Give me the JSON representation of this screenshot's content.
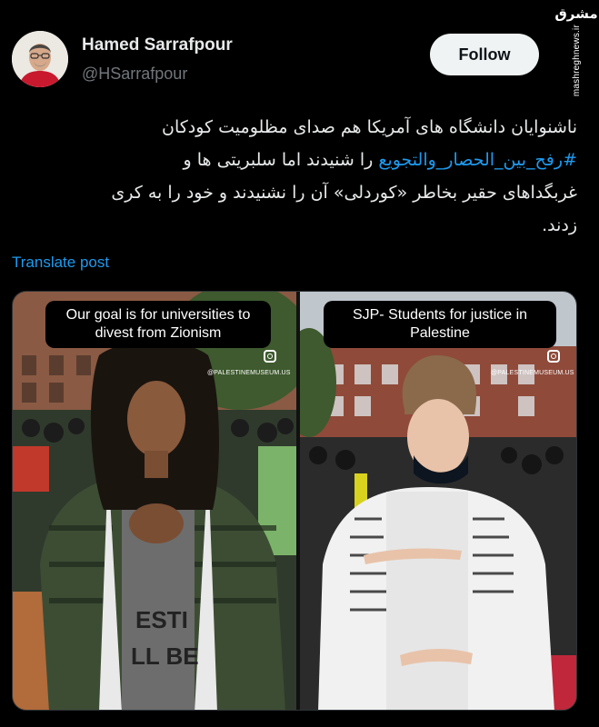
{
  "watermark": {
    "logo_text": "مشرق",
    "url": "mashreghnews.ir"
  },
  "author": {
    "name": "Hamed Sarrafpour",
    "handle": "@HSarrafpour"
  },
  "follow_label": "Follow",
  "tweet": {
    "line1": "ناشنوایان دانشگاه های آمریکا هم صدای مظلومیت کودکان",
    "hashtag": "#رفح_بین_الحصار_والتجویع",
    "line2_rest": " را شنیدند اما سلبریتی ها و",
    "line3": "غربگداهای حقیر بخاطر «کوردلی» آن را نشنیدند و خود را به کری",
    "line4": "زدند."
  },
  "translate_label": "Translate post",
  "media": {
    "left_caption": "Our goal is for universities to divest from Zionism",
    "right_caption": "SJP- Students for justice in Palestine",
    "ig_handle": "@PALESTINEMUSEUM.US",
    "shirt_text_1": "ESTI",
    "shirt_text_2": "LL BE"
  },
  "colors": {
    "background": "#000000",
    "text_primary": "#e7e9ea",
    "text_secondary": "#71767b",
    "link_blue": "#1d9bf0",
    "follow_button_bg": "#eff3f4"
  }
}
